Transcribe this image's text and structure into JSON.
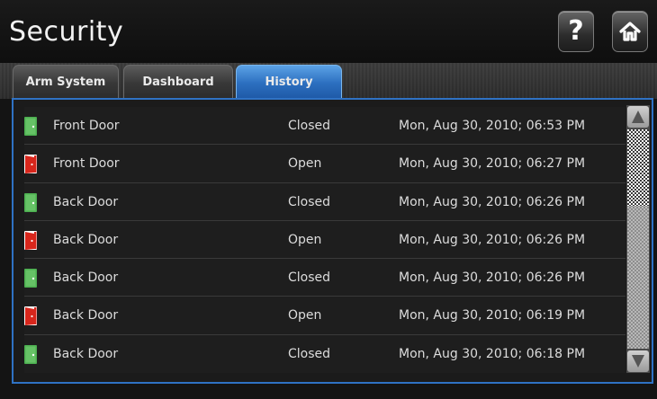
{
  "header": {
    "title": "Security",
    "help_icon": "help-icon",
    "help_glyph": "?",
    "home_icon": "home-icon"
  },
  "tabs": [
    {
      "label": "Arm System",
      "active": false
    },
    {
      "label": "Dashboard",
      "active": false
    },
    {
      "label": "History",
      "active": true
    }
  ],
  "history": [
    {
      "door": "Front Door",
      "state": "Closed",
      "time": "Mon, Aug 30, 2010; 06:53 PM",
      "icon": "door-closed-icon"
    },
    {
      "door": "Front Door",
      "state": "Open",
      "time": "Mon, Aug 30, 2010; 06:27 PM",
      "icon": "door-open-icon"
    },
    {
      "door": "Back Door",
      "state": "Closed",
      "time": "Mon, Aug 30, 2010; 06:26 PM",
      "icon": "door-closed-icon"
    },
    {
      "door": "Back Door",
      "state": "Open",
      "time": "Mon, Aug 30, 2010; 06:26 PM",
      "icon": "door-open-icon"
    },
    {
      "door": "Back Door",
      "state": "Closed",
      "time": "Mon, Aug 30, 2010; 06:26 PM",
      "icon": "door-closed-icon"
    },
    {
      "door": "Back Door",
      "state": "Open",
      "time": "Mon, Aug 30, 2010; 06:19 PM",
      "icon": "door-open-icon"
    },
    {
      "door": "Back Door",
      "state": "Closed",
      "time": "Mon, Aug 30, 2010; 06:18 PM",
      "icon": "door-closed-icon"
    }
  ],
  "scrollbar": {
    "up_icon": "scroll-up-arrow-icon",
    "down_icon": "scroll-down-arrow-icon",
    "position": 0
  },
  "colors": {
    "accent": "#2f72c4",
    "active_tab": "#3a82d2",
    "door_closed": "#4caf50",
    "door_open": "#d8261c"
  }
}
